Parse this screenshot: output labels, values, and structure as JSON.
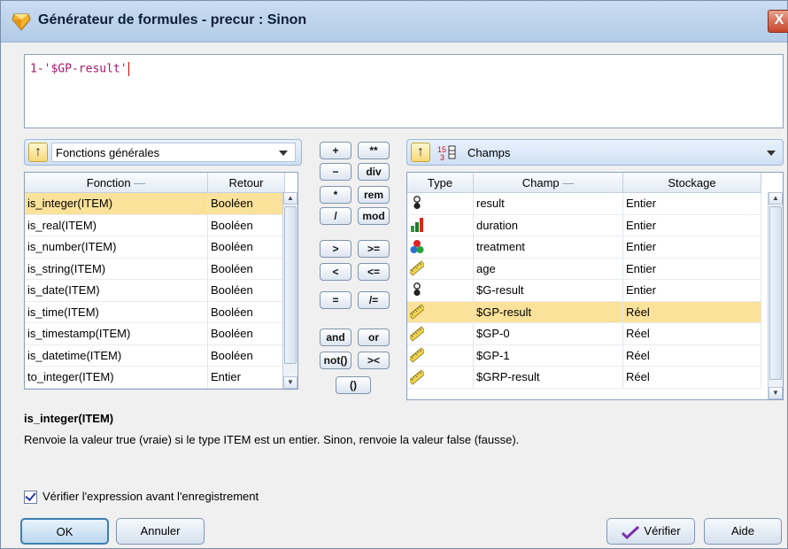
{
  "window": {
    "title": "Générateur de formules - precur : Sinon",
    "close_glyph": "X"
  },
  "expression": {
    "value": "1-'$GP-result'"
  },
  "functions_panel": {
    "selector": "Fonctions générales",
    "columns": [
      "Fonction",
      "Retour"
    ],
    "rows": [
      {
        "f": "is_integer(ITEM)",
        "r": "Booléen"
      },
      {
        "f": "is_real(ITEM)",
        "r": "Booléen"
      },
      {
        "f": "is_number(ITEM)",
        "r": "Booléen"
      },
      {
        "f": "is_string(ITEM)",
        "r": "Booléen"
      },
      {
        "f": "is_date(ITEM)",
        "r": "Booléen"
      },
      {
        "f": "is_time(ITEM)",
        "r": "Booléen"
      },
      {
        "f": "is_timestamp(ITEM)",
        "r": "Booléen"
      },
      {
        "f": "is_datetime(ITEM)",
        "r": "Booléen"
      },
      {
        "f": "to_integer(ITEM)",
        "r": "Entier"
      }
    ],
    "selected_index": 0
  },
  "operators": {
    "plus": "+",
    "power": "**",
    "minus": "−",
    "div": "div",
    "times": "*",
    "rem": "rem",
    "divide": "/",
    "mod": "mod",
    "gt": ">",
    "ge": ">=",
    "lt": "<",
    "le": "<=",
    "eq": "=",
    "ne": "/=",
    "and": "and",
    "or": "or",
    "not": "not()",
    "cmp": "><",
    "parens": "()"
  },
  "fields_panel": {
    "selector": "Champs",
    "columns": [
      "Type",
      "Champ",
      "Stockage"
    ],
    "rows": [
      {
        "icon": "flag-icon",
        "name": "result",
        "storage": "Entier"
      },
      {
        "icon": "continuous-icon",
        "name": "duration",
        "storage": "Entier"
      },
      {
        "icon": "nominal-icon",
        "name": "treatment",
        "storage": "Entier"
      },
      {
        "icon": "ruler-icon",
        "name": "age",
        "storage": "Entier"
      },
      {
        "icon": "flag-icon",
        "name": "$G-result",
        "storage": "Entier"
      },
      {
        "icon": "ruler-icon",
        "name": "$GP-result",
        "storage": "Réel"
      },
      {
        "icon": "ruler-icon",
        "name": "$GP-0",
        "storage": "Réel"
      },
      {
        "icon": "ruler-icon",
        "name": "$GP-1",
        "storage": "Réel"
      },
      {
        "icon": "ruler-icon",
        "name": "$GRP-result",
        "storage": "Réel"
      }
    ],
    "selected_index": 5
  },
  "description": {
    "title": "is_integer(ITEM)",
    "text": "Renvoie la valeur true (vraie) si le type ITEM est un entier. Sinon, renvoie la valeur false (fausse)."
  },
  "check_option": {
    "label": "Vérifier l'expression avant l'enregistrement",
    "checked": true
  },
  "buttons": {
    "ok": "OK",
    "cancel": "Annuler",
    "check": "Vérifier",
    "help": "Aide"
  }
}
